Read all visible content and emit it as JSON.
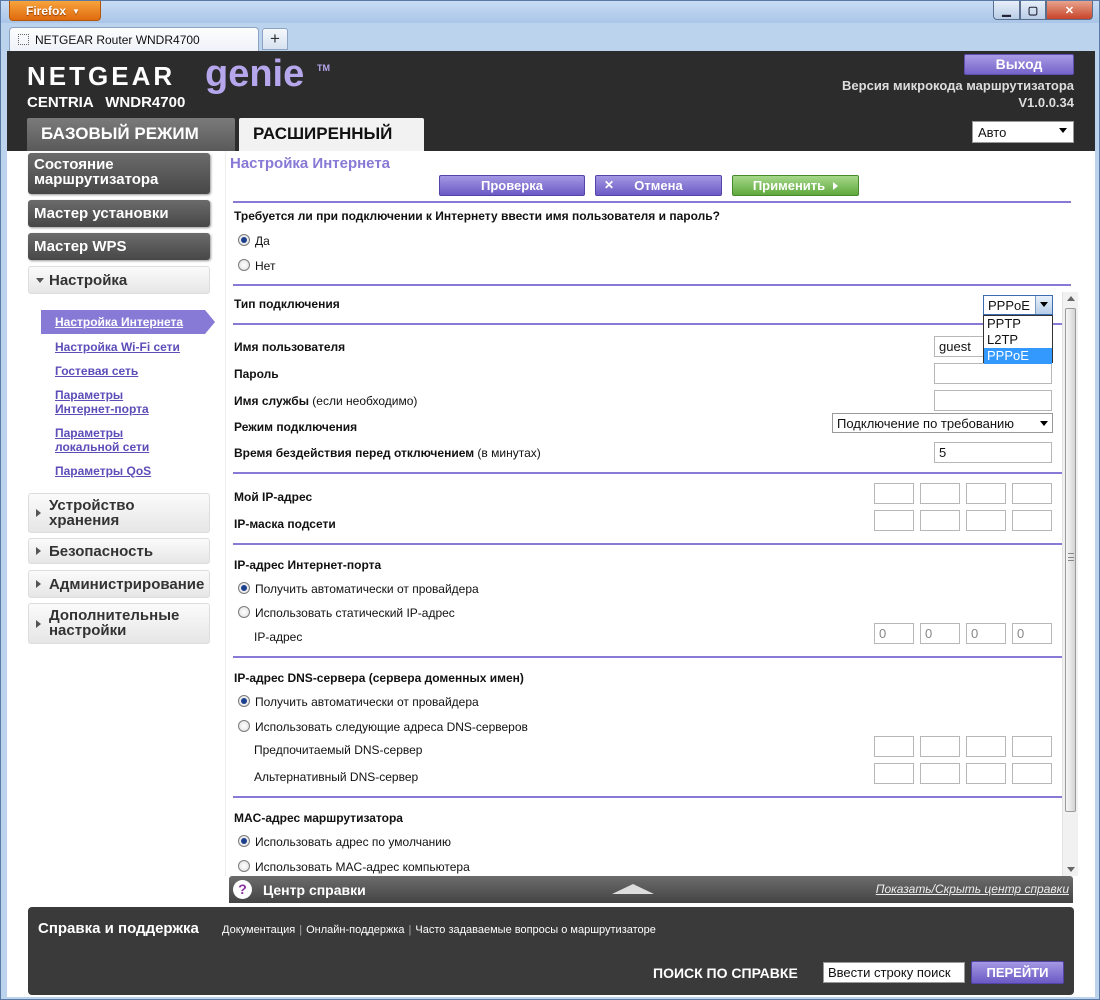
{
  "browser": {
    "menu_button": "Firefox",
    "tab_title": "NETGEAR Router WNDR4700",
    "new_tab": "+",
    "controls": {
      "minimize": "▁",
      "maximize": "▢",
      "close": "✕"
    }
  },
  "header": {
    "brand": "NETGEAR",
    "genie": "genie",
    "tm": "TM",
    "model": "CENTRIA WNDR4700",
    "logout": "Выход",
    "firmware_label": "Версия микрокода маршрутизатора",
    "firmware_version": "V1.0.0.34",
    "tabs": {
      "basic": "БАЗОВЫЙ РЕЖИМ",
      "advanced": "РАСШИРЕННЫЙ"
    },
    "language": "Авто"
  },
  "sidebar": {
    "router_status": "Состояние маршрутизатора",
    "setup_wizard": "Мастер установки",
    "wps_wizard": "Мастер WPS",
    "setup": "Настройка",
    "setup_items": [
      "Настройка Интернета",
      "Настройка Wi-Fi сети",
      "Гостевая сеть",
      "Параметры Интернет-порта",
      "Параметры локальной сети",
      "Параметры QoS"
    ],
    "storage": "Устройство хранения",
    "security": "Безопасность",
    "administration": "Администрирование",
    "advanced_settings": "Дополнительные настройки"
  },
  "content": {
    "title": "Настройка Интернета",
    "buttons": {
      "check": "Проверка",
      "cancel": "Отмена",
      "cancel_icon": "✕",
      "apply": "Применить"
    },
    "login_question": "Требуется ли при подключении к Интернету ввести имя пользователя и пароль?",
    "yes": "Да",
    "no": "Нет",
    "connection_type_label": "Тип подключения",
    "connection_type": "PPPoE",
    "connection_type_options": [
      "PPTP",
      "L2TP",
      "PPPoE"
    ],
    "username_label": "Имя пользователя",
    "username": "guest",
    "password_label": "Пароль",
    "service_name_label": "Имя службы",
    "service_name_note": " (если необходимо)",
    "connection_mode_label": "Режим подключения",
    "connection_mode": "Подключение по требованию",
    "idle_timeout_label": "Время бездействия перед отключением",
    "idle_timeout_note": " (в минутах)",
    "idle_timeout": "5",
    "my_ip_label": "Мой IP-адрес",
    "subnet_mask_label": "IP-маска подсети",
    "wan_ip_heading": "IP-адрес Интернет-порта",
    "wan_ip_auto": "Получить автоматически от провайдера",
    "wan_ip_static": "Использовать статический IP-адрес",
    "ip_address_label": "IP-адрес",
    "ip_octets": [
      "0",
      "0",
      "0",
      "0"
    ],
    "dns_heading": "IP-адрес DNS-сервера (сервера доменных имен)",
    "dns_auto": "Получить автоматически от провайдера",
    "dns_manual": "Использовать следующие адреса DNS-серверов",
    "dns_primary_label": "Предпочитаемый DNS-сервер",
    "dns_secondary_label": "Альтернативный DNS-сервер",
    "mac_heading": "MAC-адрес маршрутизатора",
    "mac_default": "Использовать адрес по умолчанию",
    "mac_computer": "Использовать MAC-адрес компьютера"
  },
  "help": {
    "icon": "?",
    "title": "Центр справки",
    "toggle": "Показать/Скрыть центр справки"
  },
  "footer": {
    "title": "Справка и поддержка",
    "links": [
      "Документация",
      "Онлайн-поддержка",
      "Часто задаваемые вопросы о маршрутизаторе"
    ],
    "search_label": "ПОИСК ПО СПРАВКЕ",
    "search_value": "Ввести строку поиск",
    "go": "ПЕРЕЙТИ"
  }
}
